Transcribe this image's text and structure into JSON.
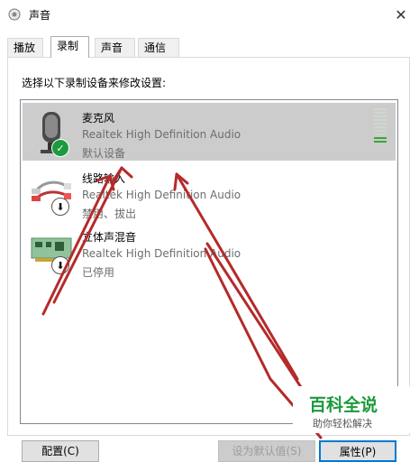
{
  "window": {
    "title": "声音"
  },
  "tabs": [
    {
      "label": "播放",
      "active": false
    },
    {
      "label": "录制",
      "active": true
    },
    {
      "label": "声音",
      "active": false
    },
    {
      "label": "通信",
      "active": false
    }
  ],
  "instruction": "选择以下录制设备来修改设置:",
  "devices": [
    {
      "name": "麦克风",
      "driver": "Realtek High Definition Audio",
      "status": "默认设备",
      "selected": true,
      "icon": "microphone-icon",
      "badge": "check"
    },
    {
      "name": "线路输入",
      "driver": "Realtek High Definition Audio",
      "status": "禁用、拔出",
      "selected": false,
      "icon": "line-in-jack-icon",
      "badge": "down-arrow"
    },
    {
      "name": "立体声混音",
      "driver": "Realtek High Definition Audio",
      "status": "已停用",
      "selected": false,
      "icon": "sound-card-icon",
      "badge": "down-arrow"
    }
  ],
  "level_meter": {
    "bars": 10,
    "lit": 2
  },
  "buttons": {
    "configure": "配置(C)",
    "set_default": "设为默认值(S)",
    "properties": "属性(P)"
  },
  "watermark": {
    "title": "百科全说",
    "subtitle": "助你轻松解决"
  },
  "colors": {
    "annotation": "#b52a2a",
    "selection": "#cccccc",
    "watermark": "#1c9a3c",
    "check": "#1d9a3d"
  }
}
